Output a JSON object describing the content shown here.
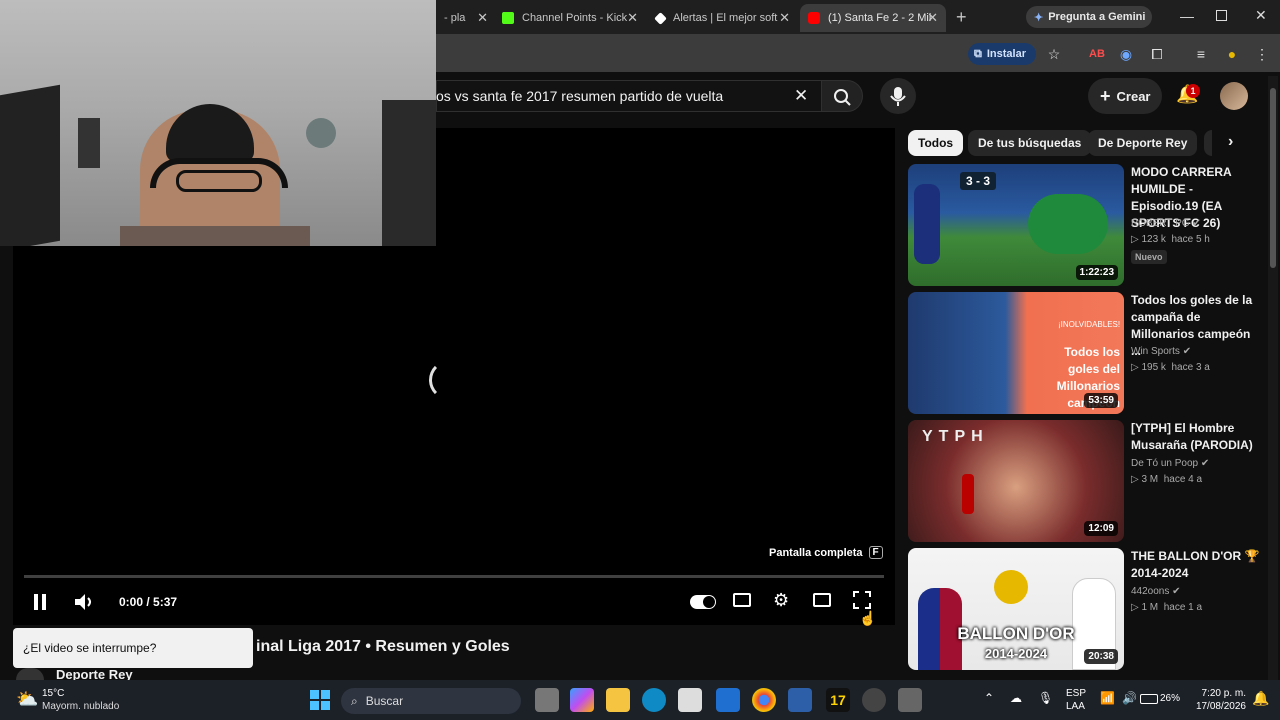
{
  "browser": {
    "tabs": [
      {
        "label": "- pla",
        "active": false
      },
      {
        "label": "Channel Points - Kick",
        "active": false
      },
      {
        "label": "Alertas | El mejor soft",
        "active": false
      },
      {
        "label": "(1) Santa Fe 2 - 2 Mil",
        "active": true
      }
    ],
    "new_tab": "+",
    "gemini": "Pregunta a Gemini",
    "install": "Instalar"
  },
  "youtube": {
    "search_value": "os vs santa fe 2017 resumen partido de vuelta",
    "create": "Crear",
    "notif_count": "1",
    "chips": [
      "Todos",
      "De tus búsquedas",
      "De Deporte Rey"
    ],
    "player": {
      "time": "0:00 / 5:37",
      "fullscreen_tip": "Pantalla completa",
      "fullscreen_key": "F",
      "interrupt": "¿El video se interrumpe?"
    },
    "video_title": "inal Liga 2017 • Resumen y Goles",
    "channel": "Deporte Rey",
    "sidebar": [
      {
        "title": "MODO CARRERA HUMILDE - Episodio.19 (EA SPORTS FC 26)",
        "channel": "ROBERT PG",
        "views": "123 k",
        "age": "hace 5 h",
        "duration": "1:22:23",
        "badge": "Nuevo",
        "thumb_text": "3 - 3"
      },
      {
        "title": "Todos los goles de la campaña de Millonarios campeón ...",
        "channel": "Win Sports",
        "views": "195 k",
        "age": "hace 3 a",
        "duration": "53:59",
        "thumb_text": "Todos los goles del Millonarios campeón",
        "thumb_sub": "¡INOLVIDABLES!"
      },
      {
        "title": "[YTPH] El Hombre Musaraña (PARODIA)",
        "channel": "De Tó un Poop",
        "views": "3 M",
        "age": "hace 4 a",
        "duration": "12:09",
        "thumb_text": "YTPH"
      },
      {
        "title": "THE BALLON D'OR 🏆 2014-2024",
        "channel": "442oons",
        "views": "1 M",
        "age": "hace 1 a",
        "duration": "20:38",
        "thumb_text": "BALLON D'OR",
        "thumb_sub": "2014-2024"
      }
    ]
  },
  "taskbar": {
    "weather_temp": "15°C",
    "weather_desc": "Mayorm. nublado",
    "search": "Buscar",
    "lang1": "ESP",
    "lang2": "LAA",
    "battery": "26%",
    "time": "7:20 p. m.",
    "date": "17/08/2026"
  },
  "colors": {
    "accent": "#ff0000",
    "bg": "#0f0f0f",
    "install": "#1a73e8"
  }
}
